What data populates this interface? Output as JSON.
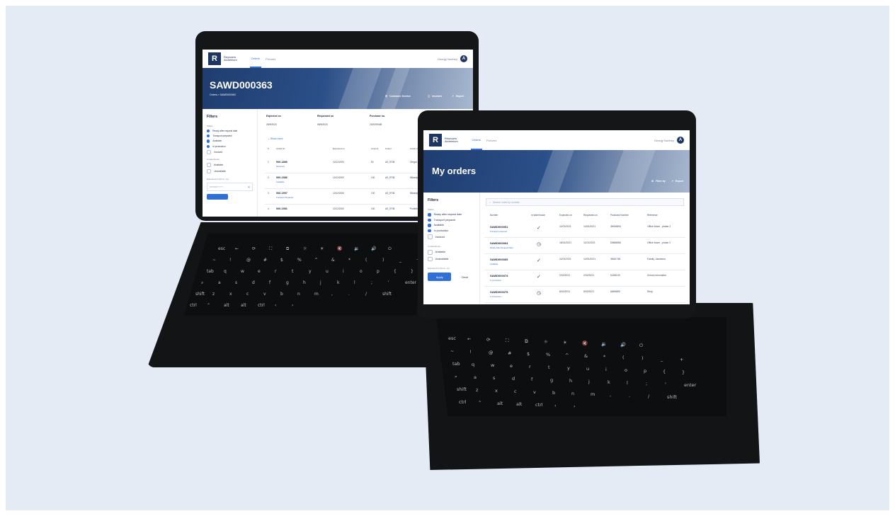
{
  "brand": {
    "line1": "Reynaers",
    "line2": "Aluminium",
    "logo_letter": "R"
  },
  "nav": {
    "tabs": [
      "Orders",
      "Pictures"
    ]
  },
  "user": {
    "name": "Georgy Northey",
    "initial": "A"
  },
  "left_screen": {
    "title": "SAWD000363",
    "breadcrumb": "Orders > SAWD000363",
    "actions": {
      "customer_service": "Customer Service",
      "invoices": "Invoices",
      "export": "Export"
    },
    "filters": {
      "title": "Filters",
      "status_label": "Status",
      "status_options": [
        {
          "label": "Ready after request date",
          "checked": true
        },
        {
          "label": "Transport prepared",
          "checked": true
        },
        {
          "label": "Available",
          "checked": true
        },
        {
          "label": "In production",
          "checked": true
        },
        {
          "label": "Invoiced",
          "checked": false
        }
      ],
      "warehouse_label": "In warehouse",
      "warehouse_options": [
        {
          "label": "Available",
          "checked": false
        },
        {
          "label": "Unavailable",
          "checked": false
        }
      ],
      "expected_label": "Expected on (from - to)",
      "expected_placeholder": "DD/MM/YYYY"
    },
    "summary": [
      {
        "label": "Expected on",
        "value": "28/9/2020"
      },
      {
        "label": "Requested on",
        "value": "08/9/2020"
      },
      {
        "label": "Purchase no.",
        "value": "2020/09/AB"
      },
      {
        "label": "Reference",
        "value": "RENOVATION Immodo"
      }
    ],
    "show_more": "Show more",
    "columns": [
      "#",
      "Article Nr.",
      "Expected on",
      "Amount",
      "Colour",
      "Article description"
    ],
    "rows": [
      {
        "no": "1",
        "article": "006.1886",
        "status": "Delivered",
        "date": "10/12/2020",
        "amount": "50",
        "colour": "AS_9T08",
        "desc": "Ohrgal 7/9980"
      },
      {
        "no": "2",
        "article": "006.1986",
        "status": "Available",
        "date": "10/12/2020",
        "amount": "100",
        "colour": "AS_9T08",
        "desc": "Milaedyn Ral"
      },
      {
        "no": "3",
        "article": "006.1997",
        "status": "Transport Prepared",
        "date": "10/12/2020",
        "amount": "100",
        "colour": "AS_9T08",
        "desc": "Milaedyn Ral"
      },
      {
        "no": "4",
        "article": "006.1981",
        "status": "",
        "date": "10/12/2020",
        "amount": "100",
        "colour": "AS_9T08",
        "desc": "Profielbalker Wosseth"
      }
    ]
  },
  "right_screen": {
    "title": "My orders",
    "actions": {
      "filter": "Filter by",
      "export": "Export"
    },
    "search_placeholder": "Search order by number",
    "filters": {
      "title": "Filters",
      "status_label": "Status",
      "status_options": [
        {
          "label": "Ready after request date",
          "checked": true
        },
        {
          "label": "Transport prepared",
          "checked": true
        },
        {
          "label": "Available",
          "checked": true
        },
        {
          "label": "In production",
          "checked": true
        },
        {
          "label": "Invoiced",
          "checked": false
        }
      ],
      "warehouse_label": "In warehouse",
      "warehouse_options": [
        {
          "label": "Available",
          "checked": false
        },
        {
          "label": "Unavailable",
          "checked": false
        }
      ],
      "expected_label": "Expected on (from - to)",
      "apply": "Apply",
      "clear": "Clear"
    },
    "columns": [
      "Number",
      "In Warehouse",
      "Expected on",
      "Requested on",
      "Purchase Number",
      "Reference"
    ],
    "rows": [
      {
        "number": "SAWD000351",
        "status": "Transport prepared",
        "icon": "✓",
        "expected": "11/01/2021",
        "requested": "14/01/2021",
        "purchase": "3MG6894",
        "reference": "Office tower - phase 2"
      },
      {
        "number": "SAWD000363",
        "status": "Ready After Request Date",
        "icon": "◷",
        "expected": "18/01/2021",
        "requested": "11/01/2021",
        "purchase": "DM86856",
        "reference": "Office tower - phase 2"
      },
      {
        "number": "SAWD000365",
        "status": "Available",
        "icon": "✓",
        "expected": "11/01/2021",
        "requested": "14/01/2021",
        "purchase": "3M61748",
        "reference": "Family, Janssens"
      },
      {
        "number": "SAWD000374",
        "status": "In production",
        "icon": "✓",
        "expected": "2/02/2021",
        "requested": "2/02/2021",
        "purchase": "K458139",
        "reference": "School renovation"
      },
      {
        "number": "SAWD000375",
        "status": "In Production",
        "icon": "◷",
        "expected": "8/02/2021",
        "requested": "8/02/2021",
        "purchase": "A865659",
        "reference": "Shop"
      }
    ]
  },
  "keyboard": {
    "row1": [
      "esc",
      "←",
      "⟳",
      "⛶",
      "⧉",
      "☼",
      "☀",
      "🔇",
      "🔉",
      "🔊",
      "⏻"
    ],
    "row2": [
      "~",
      "!",
      "@",
      "#",
      "$",
      "%",
      "^",
      "&",
      "*",
      "(",
      ")",
      "_",
      "+"
    ],
    "row3": [
      "tab",
      "q",
      "w",
      "e",
      "r",
      "t",
      "y",
      "u",
      "i",
      "o",
      "p",
      "{",
      "}"
    ],
    "row4": [
      "⌕",
      "a",
      "s",
      "d",
      "f",
      "g",
      "h",
      "j",
      "k",
      "l",
      ";",
      "'",
      "enter"
    ],
    "row5": [
      "shift",
      "z",
      "x",
      "c",
      "v",
      "b",
      "n",
      "m",
      ",",
      ".",
      "/",
      "shift"
    ],
    "row6": [
      "ctrl",
      "⌃",
      "alt",
      "alt",
      "ctrl",
      "‹",
      "›"
    ]
  },
  "colors": {
    "navy": "#1d3563",
    "accent": "#2f6fd6",
    "background": "#e4ebf4",
    "device": "#151618"
  }
}
